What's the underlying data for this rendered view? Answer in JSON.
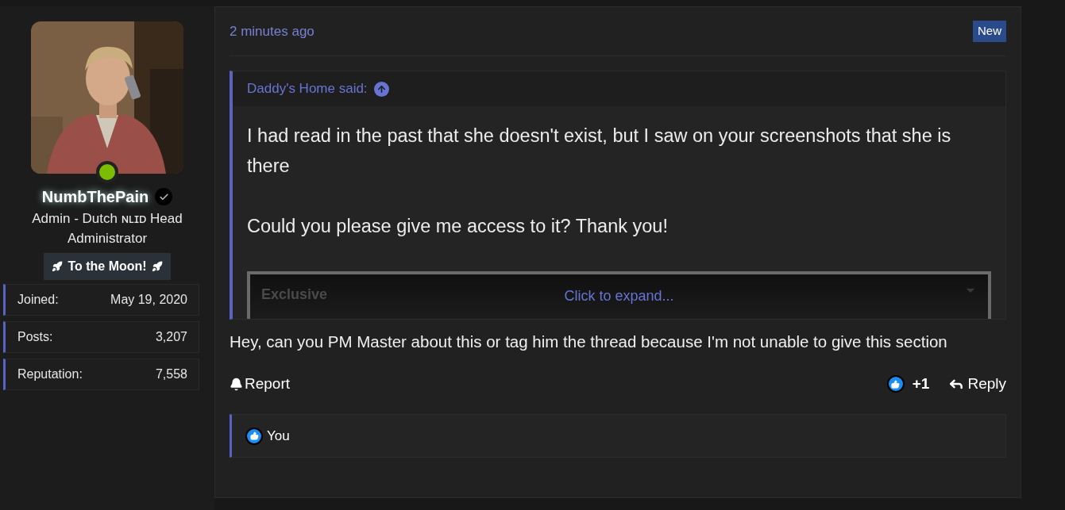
{
  "user": {
    "name": "NumbThePain",
    "online": true,
    "verified": true,
    "title": "Admin - Dutch ɴʟɪᴅ Head Administrator",
    "banner": "To the Moon!",
    "stats": [
      {
        "label": "Joined:",
        "value": "May 19, 2020"
      },
      {
        "label": "Posts:",
        "value": "3,207"
      },
      {
        "label": "Reputation:",
        "value": "7,558"
      }
    ]
  },
  "post": {
    "time": "2 minutes ago",
    "badge": "New",
    "quote": {
      "author": "Daddy's Home said:",
      "paragraphs": [
        "I had read in the past that she doesn't exist, but I saw on your screenshots that she is there",
        "Could you please give me access to it? Thank you!"
      ],
      "embedded_label": "Exclusive",
      "expand": "Click to expand..."
    },
    "message": "Hey, can you PM Master about this or tag him the thread because I'm not unable to give this section",
    "actions": {
      "report": "Report",
      "like_count": "+1",
      "reply": "Reply"
    },
    "reactions": {
      "users": "You"
    }
  }
}
